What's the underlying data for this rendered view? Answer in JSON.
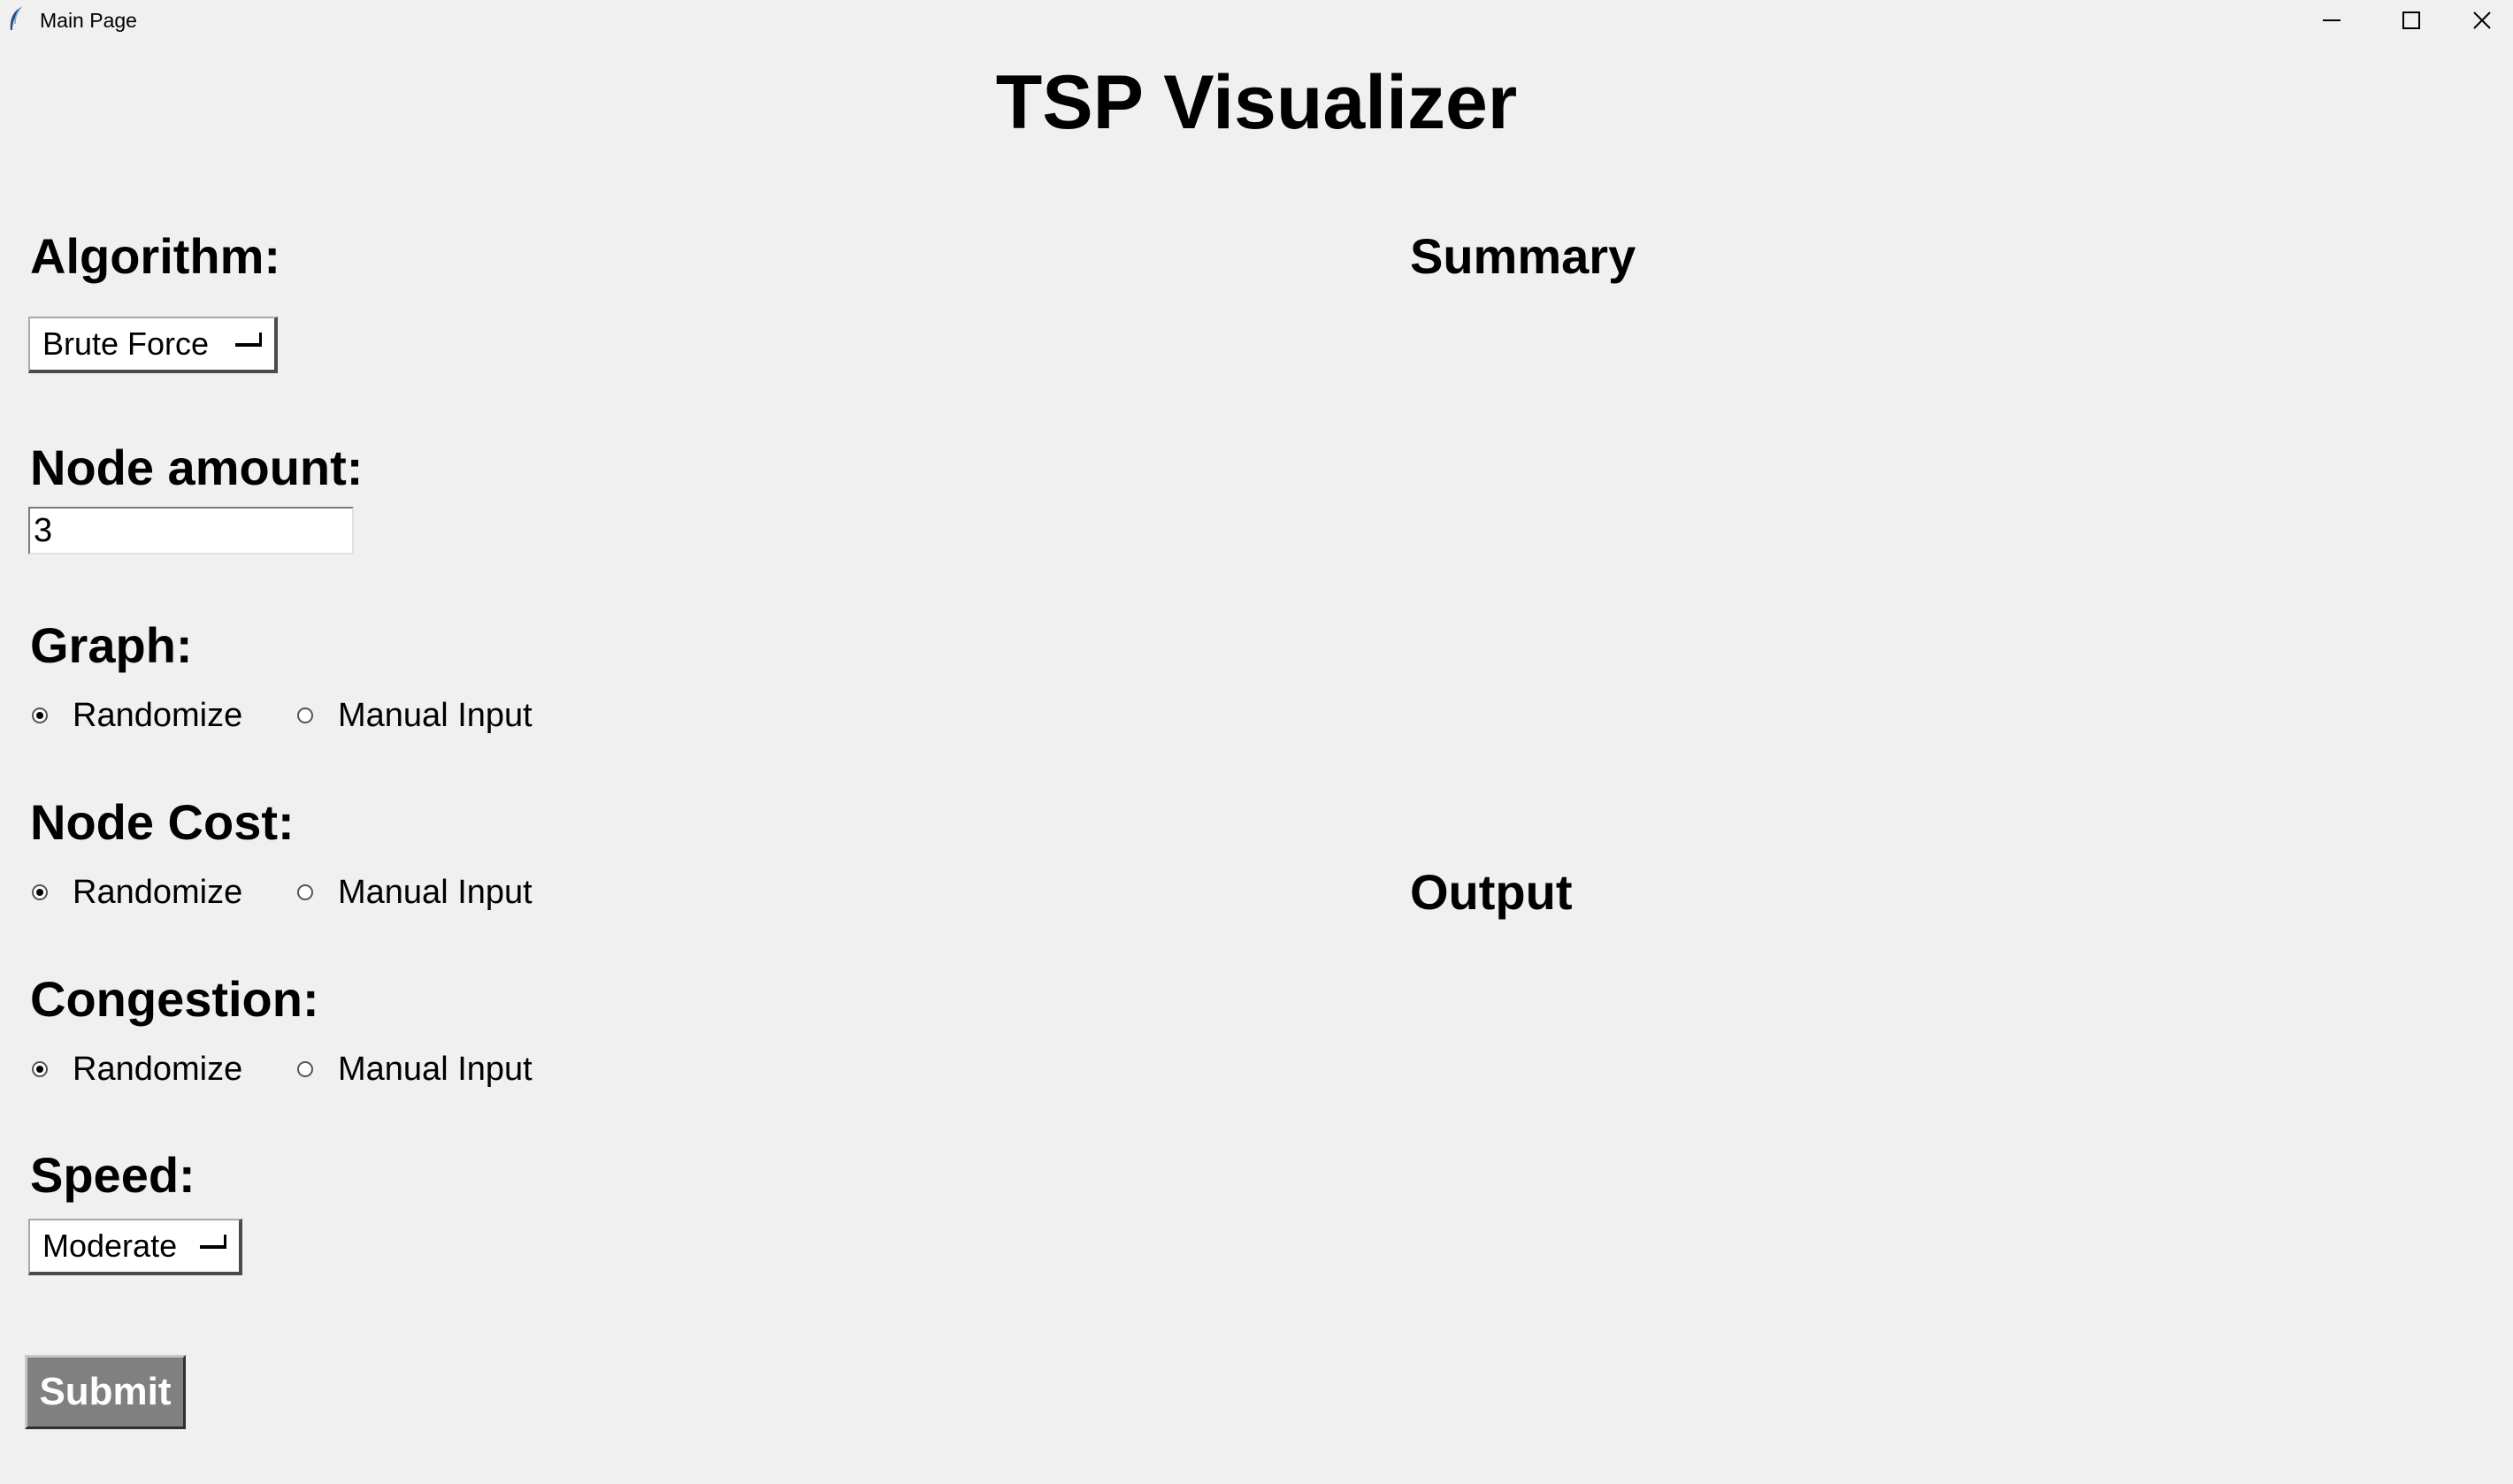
{
  "window": {
    "title": "Main Page",
    "icon": "feather-icon",
    "controls": [
      "minimize-icon",
      "maximize-icon",
      "close-icon"
    ]
  },
  "app_title": "TSP Visualizer",
  "form": {
    "algorithm": {
      "label": "Algorithm:",
      "selected": "Brute Force"
    },
    "node_amount": {
      "label": "Node amount:",
      "value": "3"
    },
    "graph": {
      "label": "Graph:",
      "options": [
        "Randomize",
        "Manual Input"
      ],
      "selected": "Randomize"
    },
    "node_cost": {
      "label": "Node Cost:",
      "options": [
        "Randomize",
        "Manual Input"
      ],
      "selected": "Randomize"
    },
    "congestion": {
      "label": "Congestion:",
      "options": [
        "Randomize",
        "Manual Input"
      ],
      "selected": "Randomize"
    },
    "speed": {
      "label": "Speed:",
      "selected": "Moderate"
    },
    "submit_label": "Submit"
  },
  "panels": {
    "summary_title": "Summary",
    "output_title": "Output"
  },
  "colors": {
    "background": "#f0f0f0",
    "submit_bg": "#808080",
    "submit_text": "#ffffff"
  }
}
